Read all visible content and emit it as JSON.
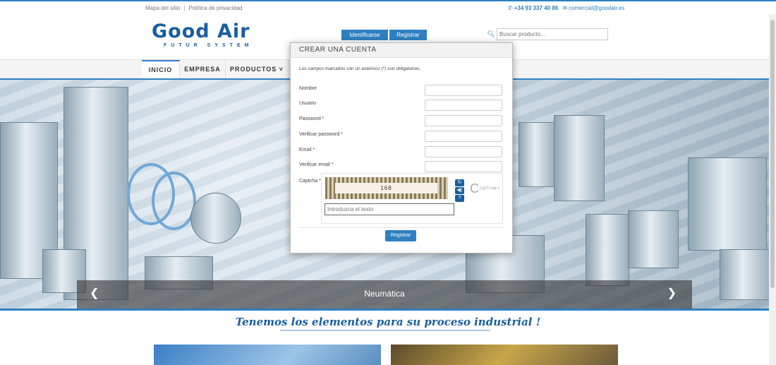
{
  "topbar": {
    "sitemap": "Mapa del sitio",
    "separator": "|",
    "privacy": "Política de privacidad",
    "phone": "+34 93 337 40 86",
    "email": "comercial@goodair.es"
  },
  "header": {
    "logo_main": "Good Air",
    "logo_sub": "FUTUR SYSTEM",
    "login_button": "Identificarse",
    "register_button": "Registrar",
    "search_placeholder": "Buscar producto..."
  },
  "nav": {
    "items": [
      {
        "label": "INICIO",
        "active": true
      },
      {
        "label": "EMPRESA",
        "active": false
      },
      {
        "label": "PRODUCTOS ˅",
        "active": false
      }
    ]
  },
  "hero": {
    "caption": "Neumática",
    "prev": "❮",
    "next": "❯",
    "dots": "● ● ● ● ● ● ● ● ●"
  },
  "tagline": "Tenemos los elementos para su proceso industrial !",
  "modal": {
    "title": "CREAR UNA CUENTA",
    "note": "Los campos marcados con un asterisco (*) son obligatorios.",
    "fields": [
      {
        "label": "Nombre"
      },
      {
        "label": "Usuario"
      },
      {
        "label": "Password *"
      },
      {
        "label": "Verificar password *"
      },
      {
        "label": "Email *"
      },
      {
        "label": "Verificar email *"
      },
      {
        "label": "Captcha *"
      }
    ],
    "captcha_text": "168",
    "captcha_placeholder": "Introduzca el texto",
    "captcha_brand": "CAPTCHA™",
    "submit": "Registrar"
  },
  "colors": {
    "accent": "#2f7fc1",
    "brand": "#1a5e9e"
  }
}
